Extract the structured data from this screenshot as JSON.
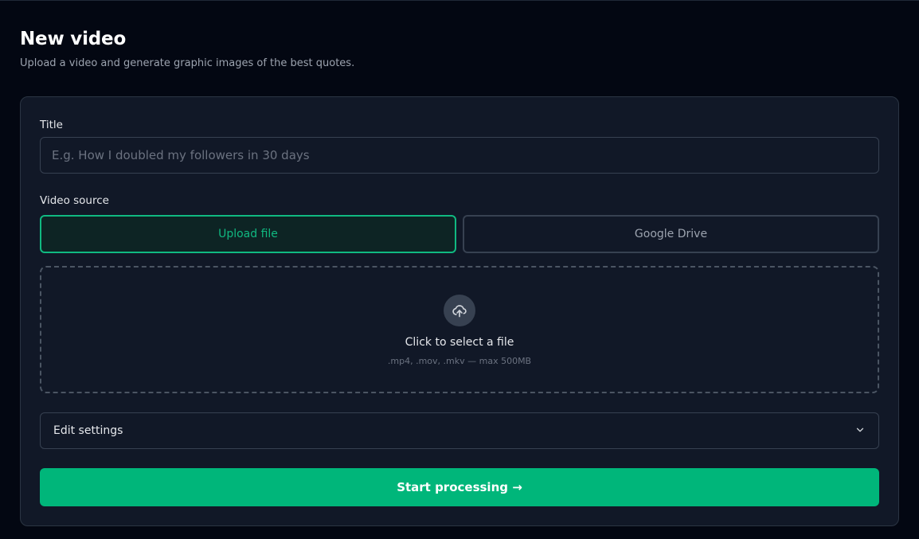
{
  "header": {
    "title": "New video",
    "subtitle": "Upload a video and generate graphic images of the best quotes."
  },
  "form": {
    "title_label": "Title",
    "title_placeholder": "E.g. How I doubled my followers in 30 days",
    "title_value": "",
    "source_label": "Video source",
    "sources": [
      {
        "label": "Upload file",
        "selected": true
      },
      {
        "label": "Google Drive",
        "selected": false
      }
    ],
    "dropzone": {
      "icon": "upload-cloud-icon",
      "main_text": "Click to select a file",
      "sub_text": ".mp4, .mov, .mkv — max 500MB"
    },
    "settings": {
      "label": "Edit settings",
      "icon": "chevron-down-icon"
    },
    "submit_label": "Start processing →"
  },
  "colors": {
    "background": "#030712",
    "card": "#111827",
    "accent": "#10b981",
    "primary_button": "#00b67a",
    "border": "#374151"
  }
}
